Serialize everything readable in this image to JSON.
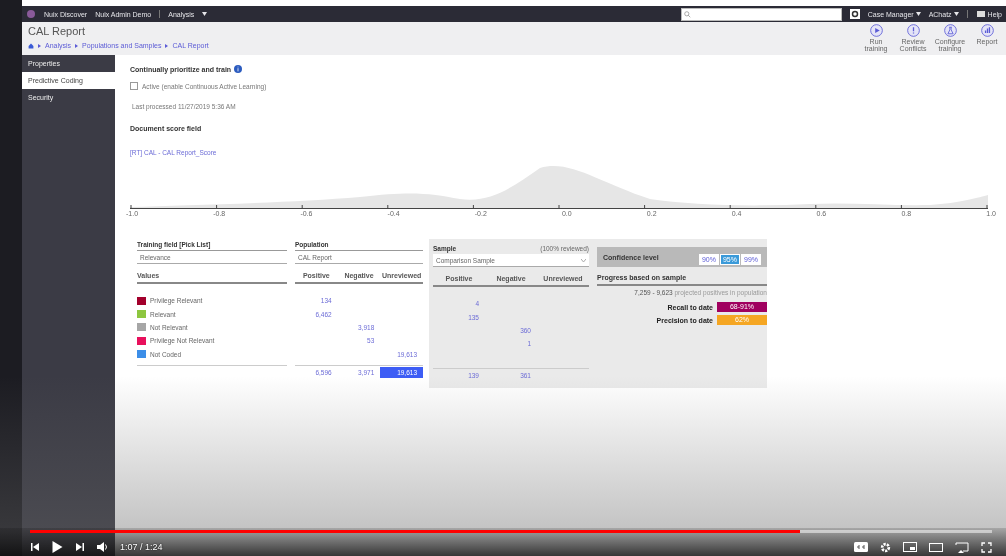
{
  "top_bar": {
    "app_name": "Nuix Discover",
    "case_name": "Nuix Admin Demo",
    "menu": "Analysis",
    "user_menus": [
      "Case Manager",
      "AChatz"
    ],
    "help": "Help"
  },
  "header": {
    "title": "CAL Report",
    "breadcrumb": [
      "Analysis",
      "Populations and Samples",
      "CAL Report"
    ],
    "actions": [
      {
        "kind": "play",
        "label": "Run training"
      },
      {
        "kind": "alert",
        "label": "Review Conflicts"
      },
      {
        "kind": "flask",
        "label": "Configure training"
      },
      {
        "kind": "chart",
        "label": "Report"
      }
    ]
  },
  "sidebar": {
    "items": [
      {
        "label": "Properties",
        "selected": false
      },
      {
        "label": "Predictive Coding",
        "selected": true
      },
      {
        "label": "Security",
        "selected": false
      }
    ]
  },
  "section": {
    "title": "Continually prioritize and train",
    "active": {
      "label": "Active (enable Continuous Active Learning)",
      "checked": false
    },
    "last_processed": "Last processed 11/27/2019 5:36 AM",
    "score_field_label": "Document score field",
    "score_field_link": "[RT] CAL - CAL Report_Score"
  },
  "score_axis": {
    "ticks": [
      "-1.0",
      "-0.8",
      "-0.6",
      "-0.4",
      "-0.2",
      "0.0",
      "0.2",
      "0.4",
      "0.6",
      "0.8",
      "1.0"
    ]
  },
  "training_table": {
    "title": "Training field [Pick List]",
    "field": "Relevance",
    "column": "Values",
    "rows": [
      {
        "label": "Privilege Relevant",
        "color": "#a3002c"
      },
      {
        "label": "Relevant",
        "color": "#8dc63f"
      },
      {
        "label": "Not Relevant",
        "color": "#a6a6a6"
      },
      {
        "label": "Privilege Not Relevant",
        "color": "#e8105c"
      },
      {
        "label": "Not Coded",
        "color": "#3c8ee8"
      }
    ]
  },
  "population": {
    "title": "Population",
    "select": "CAL Report",
    "columns": [
      "Positive",
      "Negative",
      "Unreviewed"
    ],
    "rows": [
      [
        "134",
        "",
        ""
      ],
      [
        "6,462",
        "",
        ""
      ],
      [
        "",
        "3,918",
        ""
      ],
      [
        "",
        "53",
        ""
      ],
      [
        "",
        "",
        "19,613"
      ]
    ],
    "totals": [
      {
        "value": "6,596",
        "selected": false
      },
      {
        "value": "3,971",
        "selected": false
      },
      {
        "value": "19,613",
        "selected": true
      }
    ]
  },
  "sample": {
    "title": "Sample",
    "reviewed": "(100% reviewed)",
    "select": "Comparison Sample",
    "columns": [
      "Positive",
      "Negative",
      "Unreviewed"
    ],
    "rows": [
      [
        "4",
        "",
        ""
      ],
      [
        "135",
        "",
        ""
      ],
      [
        "",
        "360",
        ""
      ],
      [
        "",
        "1",
        ""
      ],
      [
        "",
        "",
        ""
      ]
    ],
    "totals": [
      {
        "value": "139",
        "selected": false
      },
      {
        "value": "361",
        "selected": false
      },
      {
        "selected": false
      }
    ]
  },
  "confidence": {
    "title": "Confidence level",
    "options": [
      {
        "label": "90%",
        "selected": false
      },
      {
        "label": "95%",
        "selected": true
      },
      {
        "label": "99%",
        "selected": false
      }
    ],
    "progress_title": "Progress based on sample",
    "projected_range": "7,259 - 9,623",
    "projected_text": "projected positives in population",
    "metrics": [
      {
        "label": "Recall to date",
        "value": "68-91%",
        "color": "#a0005f"
      },
      {
        "label": "Precision to date",
        "value": "62%",
        "color": "#f5a623"
      }
    ]
  },
  "video": {
    "level": 0.8,
    "time": "1:07 / 1:24"
  }
}
